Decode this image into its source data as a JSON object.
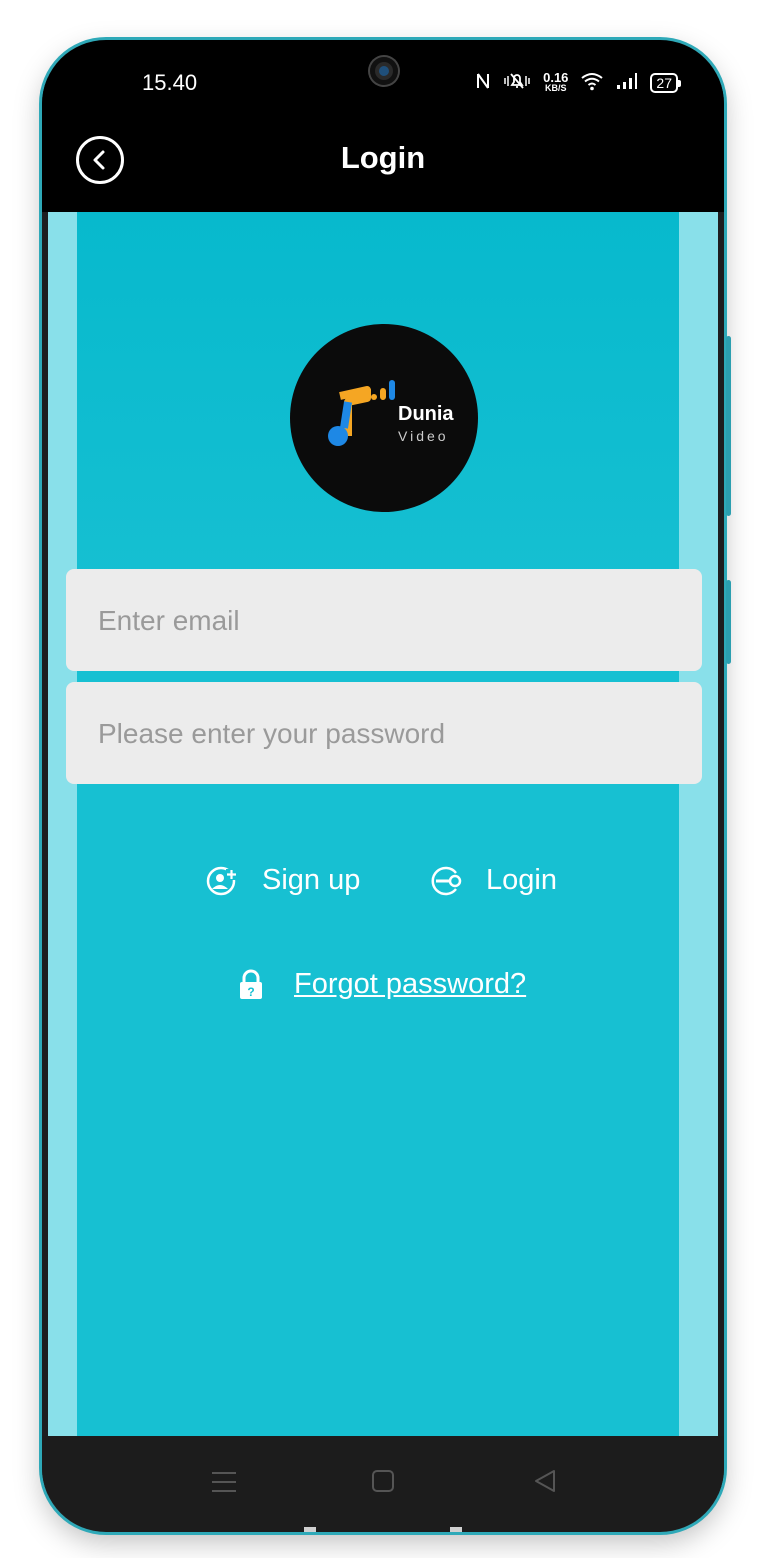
{
  "status_bar": {
    "time": "15.40",
    "net_speed_value": "0.16",
    "net_speed_unit": "KB/S",
    "battery": "27",
    "icons": [
      "nfc-icon",
      "mute-vibrate-icon",
      "wifi-icon",
      "signal-icon",
      "battery-icon"
    ]
  },
  "header": {
    "title": "Login"
  },
  "logo": {
    "word": "Dunia",
    "sub": "Video"
  },
  "form": {
    "email_placeholder": "Enter email",
    "email_value": "",
    "password_placeholder": "Please enter your password",
    "password_value": ""
  },
  "actions": {
    "signup_label": "Sign up",
    "login_label": "Login",
    "forgot_label": "Forgot password?"
  },
  "colors": {
    "screen_bg": "#17c0d2",
    "header_bg": "#000000",
    "field_bg": "#ececec",
    "logo_accent_orange": "#f5a623",
    "logo_accent_blue": "#1e88e5"
  }
}
